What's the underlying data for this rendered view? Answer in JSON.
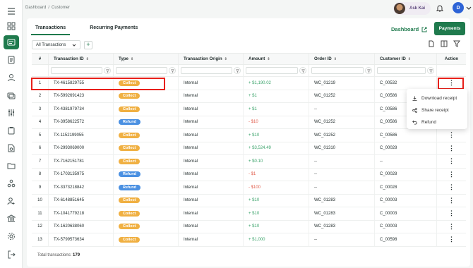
{
  "breadcrumb": [
    "Dashboard",
    "Customer"
  ],
  "user": {
    "name": "Ask Kai",
    "initial": "D"
  },
  "tabs": [
    "Transactions",
    "Recurring Payments"
  ],
  "dashboard_link": "Dashboard",
  "payments_button": "Payments",
  "filter": {
    "selected": "All Transactions",
    "add": "+"
  },
  "columns": [
    "#",
    "Transaction ID",
    "Type",
    "Transaction Origin",
    "Amount",
    "Order ID",
    "Customer ID",
    "Action"
  ],
  "rows": [
    {
      "n": "1",
      "id": "TX-4615829755",
      "type": "Collect",
      "origin": "Internal",
      "amount": "+ $1,190.02",
      "sign": "pos",
      "order": "WC_01219",
      "cust": "C_00532"
    },
    {
      "n": "2",
      "id": "TX-5992691423",
      "type": "Collect",
      "origin": "Internal",
      "amount": "+ $1",
      "sign": "pos",
      "order": "WC_01252",
      "cust": "C_00586"
    },
    {
      "n": "3",
      "id": "TX-4381979734",
      "type": "Collect",
      "origin": "Internal",
      "amount": "+ $1",
      "sign": "pos",
      "order": "--",
      "cust": "C_00586"
    },
    {
      "n": "4",
      "id": "TX-3958622572",
      "type": "Refund",
      "origin": "Internal",
      "amount": "- $10",
      "sign": "neg",
      "order": "WC_01252",
      "cust": "C_00586"
    },
    {
      "n": "5",
      "id": "TX-1152199055",
      "type": "Collect",
      "origin": "Internal",
      "amount": "+ $10",
      "sign": "pos",
      "order": "WC_01252",
      "cust": "C_00586"
    },
    {
      "n": "6",
      "id": "TX-2993069000",
      "type": "Collect",
      "origin": "Internal",
      "amount": "+ $3,524.49",
      "sign": "pos",
      "order": "WC_01310",
      "cust": "C_00028"
    },
    {
      "n": "7",
      "id": "TX-7162151781",
      "type": "Collect",
      "origin": "Internal",
      "amount": "+ $0.10",
      "sign": "pos",
      "order": "--",
      "cust": "--"
    },
    {
      "n": "8",
      "id": "TX-1703135975",
      "type": "Refund",
      "origin": "Internal",
      "amount": "- $1",
      "sign": "neg",
      "order": "--",
      "cust": "C_00028"
    },
    {
      "n": "9",
      "id": "TX-3373218842",
      "type": "Refund",
      "origin": "Internal",
      "amount": "- $100",
      "sign": "neg",
      "order": "--",
      "cust": "C_00028"
    },
    {
      "n": "10",
      "id": "TX-6148851645",
      "type": "Collect",
      "origin": "Internal",
      "amount": "+ $10",
      "sign": "pos",
      "order": "WC_01283",
      "cust": "C_00003"
    },
    {
      "n": "11",
      "id": "TX-1041779218",
      "type": "Collect",
      "origin": "Internal",
      "amount": "+ $10",
      "sign": "pos",
      "order": "WC_01283",
      "cust": "C_00003"
    },
    {
      "n": "12",
      "id": "TX-1620638060",
      "type": "Collect",
      "origin": "Internal",
      "amount": "+ $10",
      "sign": "pos",
      "order": "WC_01283",
      "cust": "C_00003"
    },
    {
      "n": "13",
      "id": "TX-5799573634",
      "type": "Collect",
      "origin": "Internal",
      "amount": "+ $1,000",
      "sign": "pos",
      "order": "--",
      "cust": "C_00598"
    }
  ],
  "footer": {
    "label": "Total transactions:",
    "count": "179"
  },
  "menu": [
    "Download receipt",
    "Share receipt",
    "Refund"
  ],
  "colors": {
    "brand": "#1f7a4d",
    "collect": "#f0b042",
    "refund": "#4a90e2",
    "positive": "#3aa36a",
    "negative": "#e05a48",
    "highlight": "#e8201a"
  }
}
